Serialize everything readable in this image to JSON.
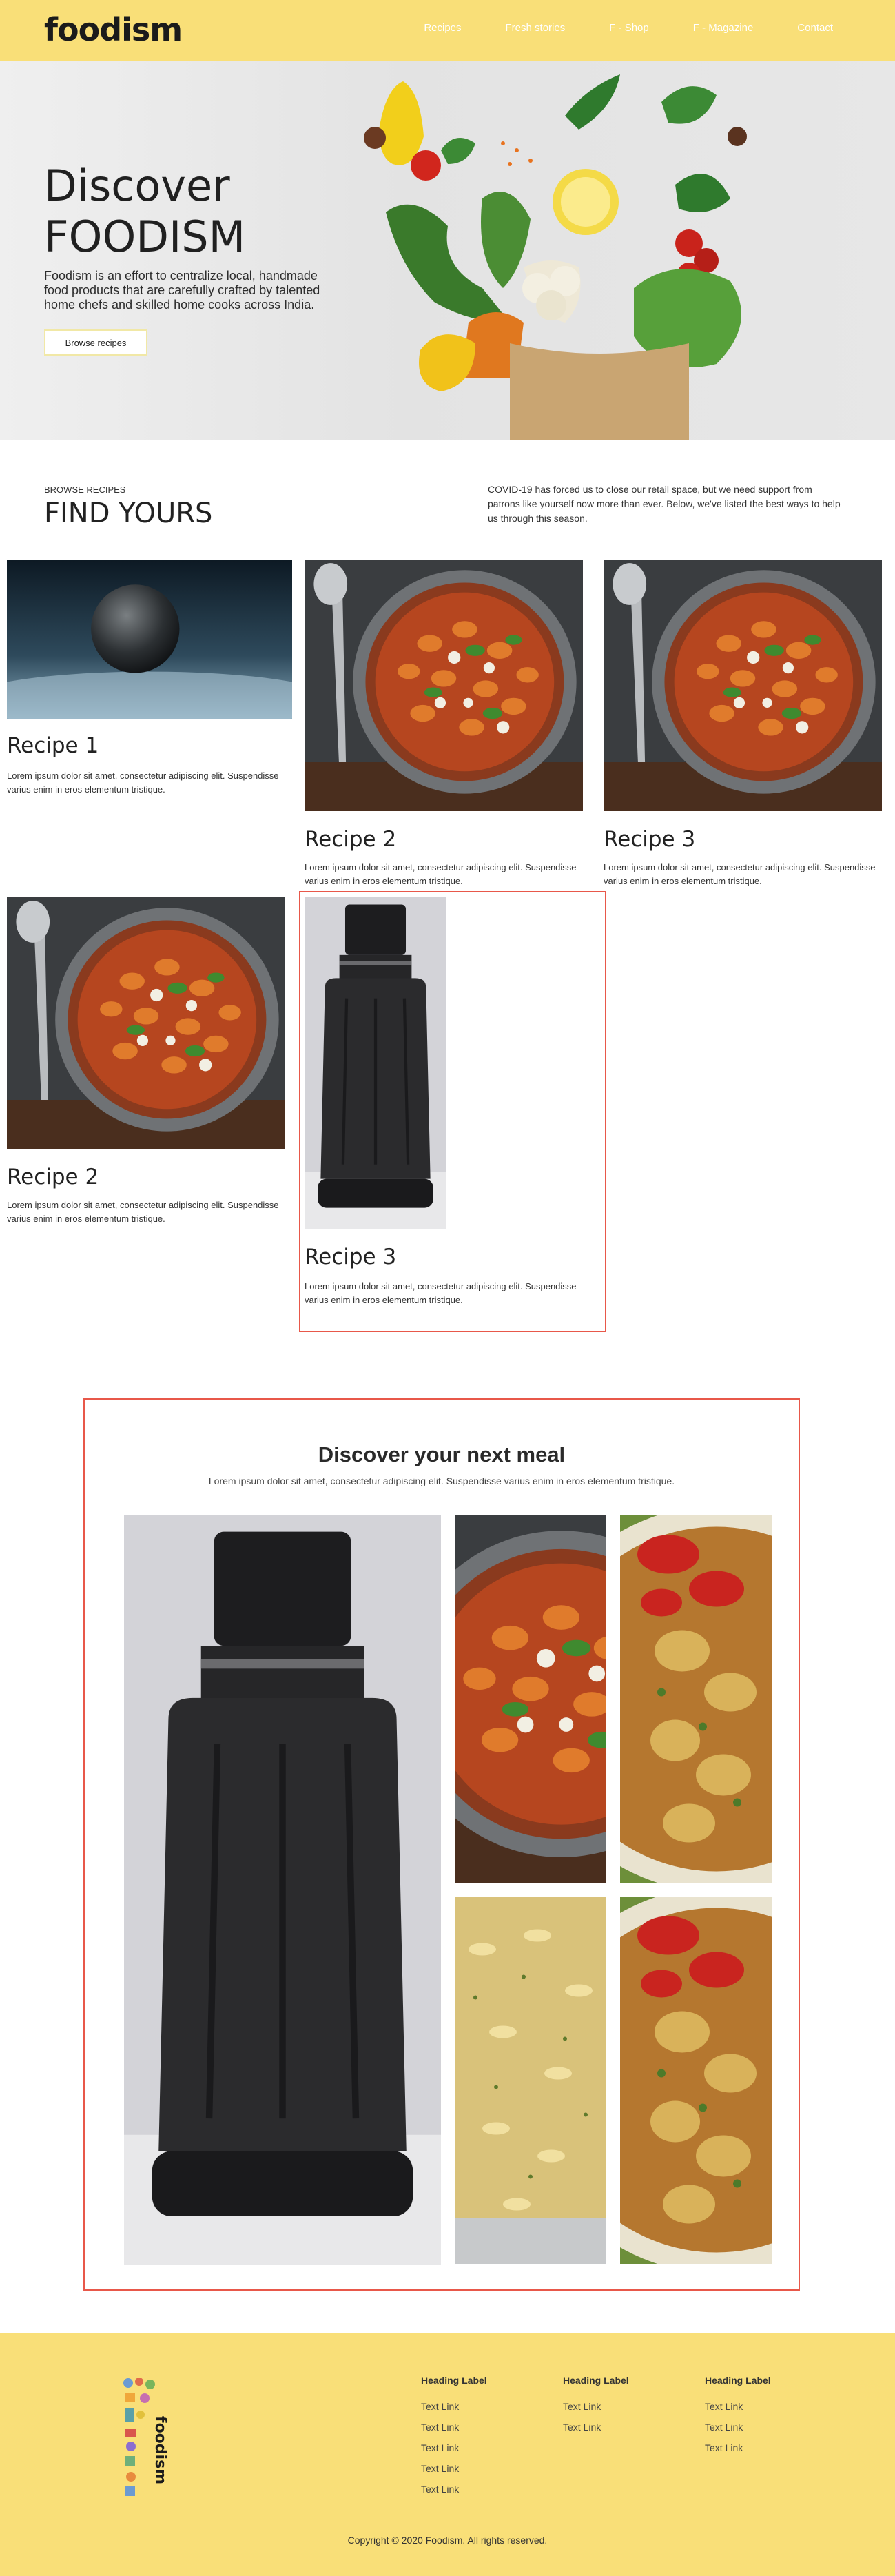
{
  "header": {
    "logo": "foodism",
    "nav": [
      "Recipes",
      "Fresh stories",
      "F - Shop",
      "F - Magazine",
      "Contact"
    ]
  },
  "hero": {
    "title_line1": "Discover",
    "title_line2": "FOODISM",
    "description": "Foodism is an effort to centralize local, handmade food products that are carefully crafted by talented home chefs and skilled home cooks across India.",
    "button": "Browse recipes"
  },
  "browse": {
    "eyebrow": "BROWSE RECIPES",
    "title": "FIND YOURS",
    "notice": "COVID-19 has forced us to close our retail space, but we need support from patrons like yourself now more than ever. Below, we've listed the best ways to help us through this season."
  },
  "recipes": [
    {
      "title": "Recipe 1",
      "text": "Lorem ipsum dolor sit amet, consectetur adipiscing elit. Suspendisse varius enim in eros elementum tristique.",
      "image": "planet"
    },
    {
      "title": "Recipe 2",
      "text": "Lorem ipsum dolor sit amet, consectetur adipiscing elit. Suspendisse varius enim in eros elementum tristique.",
      "image": "gnocchi"
    },
    {
      "title": "Recipe 3",
      "text": "Lorem ipsum dolor sit amet, consectetur adipiscing elit. Suspendisse varius enim in eros elementum tristique.",
      "image": "gnocchi"
    },
    {
      "title": "Recipe 2",
      "text": "Lorem ipsum dolor sit amet, consectetur adipiscing elit. Suspendisse varius enim in eros elementum tristique.",
      "image": "gnocchi"
    },
    {
      "title": "Recipe 3",
      "text": "Lorem ipsum dolor sit amet, consectetur adipiscing elit. Suspendisse varius enim in eros elementum tristique.",
      "image": "monocular"
    }
  ],
  "gallery": {
    "title": "Discover your next meal",
    "subtitle": "Lorem ipsum dolor sit amet, consectetur adipiscing elit. Suspendisse varius enim in eros elementum tristique."
  },
  "footer": {
    "columns": [
      {
        "heading": "Heading Label",
        "links": [
          "Text Link",
          "Text Link",
          "Text Link",
          "Text Link",
          "Text Link"
        ]
      },
      {
        "heading": "Heading Label",
        "links": [
          "Text Link",
          "Text Link"
        ]
      },
      {
        "heading": "Heading Label",
        "links": [
          "Text Link",
          "Text Link",
          "Text Link"
        ]
      }
    ],
    "logo_text": "foodism",
    "copyright": "Copyright © 2020 Foodism. All rights reserved."
  },
  "colors": {
    "brand_yellow": "#f9df78",
    "selection_red": "#e8584a"
  }
}
